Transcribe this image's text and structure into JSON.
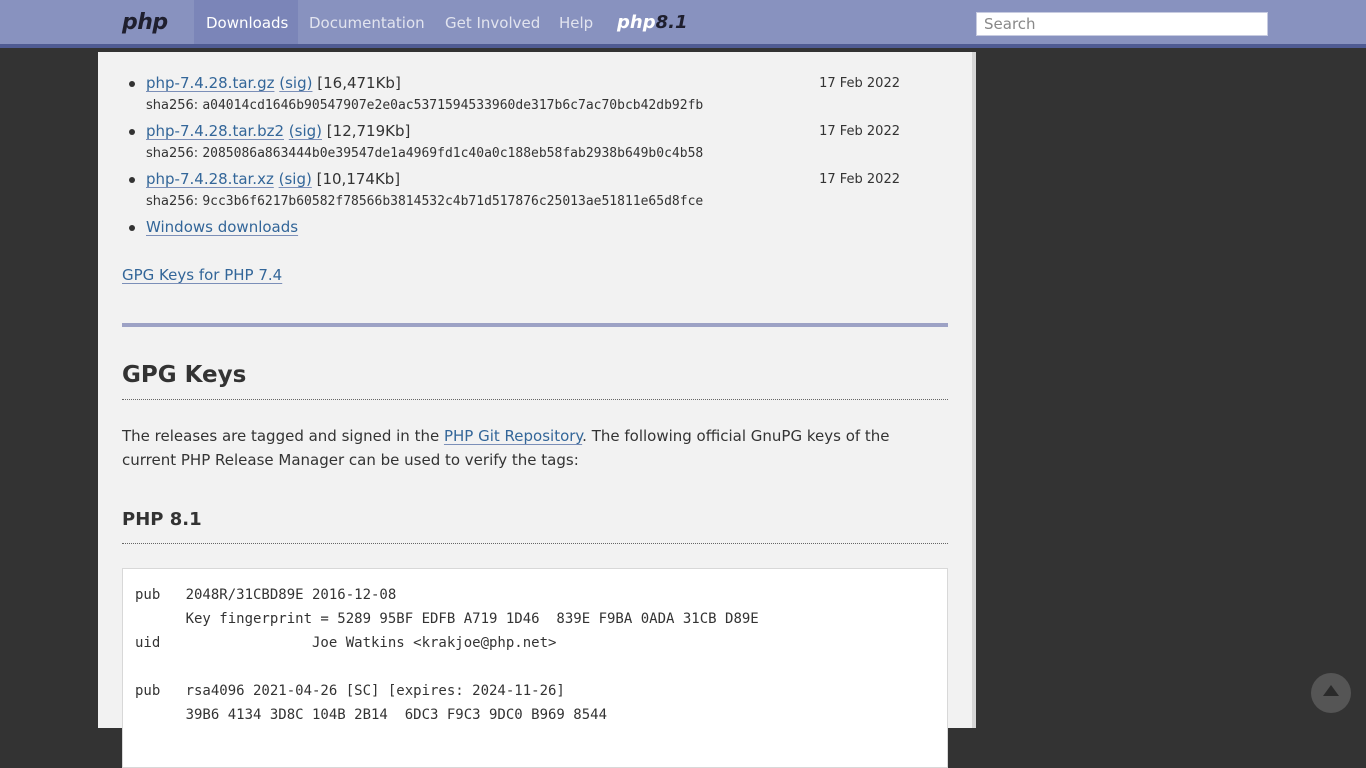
{
  "nav": {
    "logo": "php",
    "items": [
      {
        "label": "Downloads"
      },
      {
        "label": "Documentation"
      },
      {
        "label": "Get Involved"
      },
      {
        "label": "Help"
      }
    ],
    "version_logo_prefix": "php",
    "version_logo_num": "8.1",
    "search_placeholder": "Search"
  },
  "downloads": [
    {
      "file": "php-7.4.28.tar.gz",
      "sig": "(sig)",
      "size": "[16,471Kb]",
      "date": "17 Feb 2022",
      "sha_label": "sha256:",
      "sha": "a04014cd1646b90547907e2e0ac5371594533960de317b6c7ac70bcb42db92fb"
    },
    {
      "file": "php-7.4.28.tar.bz2",
      "sig": "(sig)",
      "size": "[12,719Kb]",
      "date": "17 Feb 2022",
      "sha_label": "sha256:",
      "sha": "2085086a863444b0e39547de1a4969fd1c40a0c188eb58fab2938b649b0c4b58"
    },
    {
      "file": "php-7.4.28.tar.xz",
      "sig": "(sig)",
      "size": "[10,174Kb]",
      "date": "17 Feb 2022",
      "sha_label": "sha256:",
      "sha": "9cc3b6f6217b60582f78566b3814532c4b71d517876c25013ae51811e65d8fce"
    }
  ],
  "windows_downloads": "Windows downloads",
  "gpg_link_74": "GPG Keys for PHP 7.4",
  "gpg_section": {
    "title": "GPG Keys",
    "para_before": "The releases are tagged and signed in the ",
    "para_link": "PHP Git Repository",
    "para_after": ". The following official GnuPG keys of the current PHP Release Manager can be used to verify the tags:",
    "subtitle": "PHP 8.1",
    "code_lines": [
      "pub   2048R/31CBD89E 2016-12-08",
      "      Key fingerprint = 5289 95BF EDFB A719 1D46  839E F9BA 0ADA 31CB D89E",
      "uid                  Joe Watkins <krakjoe@php.net>",
      "",
      "pub   rsa4096 2021-04-26 [SC] [expires: 2024-11-26]",
      "      39B6 4134 3D8C 104B 2B14  6DC3 F9C3 9DC0 B969 8544"
    ]
  }
}
